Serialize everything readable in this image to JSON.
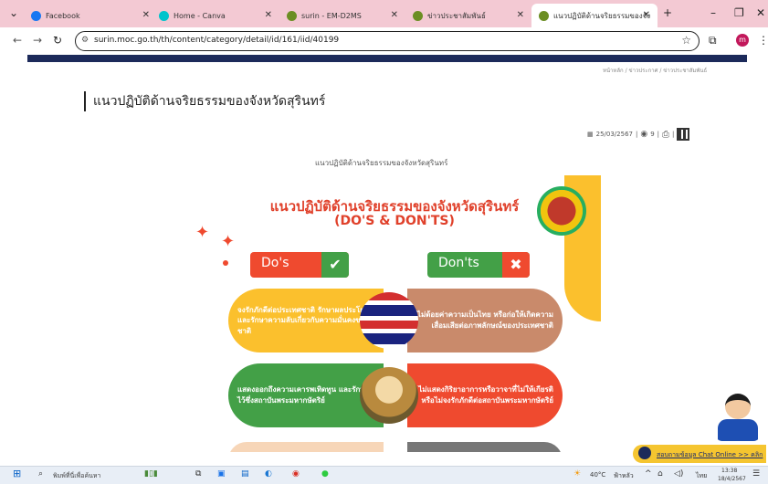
{
  "browser": {
    "tabs": [
      {
        "title": "Facebook",
        "color": "#1877f2",
        "active": false
      },
      {
        "title": "Home - Canva",
        "color": "#00c4cc",
        "active": false
      },
      {
        "title": "surin - EM-D2MS",
        "color": "#6b8e23",
        "active": false
      },
      {
        "title": "ข่าวประชาสัมพันธ์",
        "color": "#6b8e23",
        "active": false
      },
      {
        "title": "แนวปฏิบัติด้านจริยธรรมของจังหวัดสุ",
        "color": "#6b8e23",
        "active": true
      }
    ],
    "new_tab": "+",
    "url": "surin.moc.go.th/th/content/category/detail/id/161/iid/40199",
    "profile_initial": "m"
  },
  "page": {
    "breadcrumb": "หน้าหลัก / ข่าวประกาศ / ข่าวประชาสัมพันธ์",
    "title": "แนวปฏิบัติด้านจริยธรรมของจังหวัดสุรินทร์",
    "date": "25/03/2567",
    "views": "9",
    "caption": "แนวปฏิบัติด้านจริยธรรมของจังหวัดสุรินทร์"
  },
  "poster": {
    "title": "แนวปฏิบัติด้านจริยธรรมของจังหวัดสุรินทร์",
    "subtitle": "(DO'S & DON'TS)",
    "dos_label": "Do's",
    "donts_label": "Don'ts",
    "dos": [
      "จงรักภักดีต่อประเทศชาติ รักษาผลประโยชน์ และรักษาความลับเกี่ยวกับความมั่นคงของชาติ",
      "แสดงออกถึงความเคารพเทิดทูน และรักษาไว้ซึ่งสถาบันพระมหากษัตริย์"
    ],
    "donts": [
      "ไม่ด้อยค่าความเป็นไทย หรือก่อให้เกิดความเสื่อมเสียต่อภาพลักษณ์ของประเทศชาติ",
      "ไม่แสดงกิริยาอาการหรือวาจาที่ไม่ให้เกียรติหรือไม่จงรักภักดีต่อสถาบันพระมหากษัตริย์"
    ],
    "colors": {
      "red": "#ef4a2f",
      "green": "#43a047",
      "yellow": "#fbc02d",
      "brown": "#c98a6b"
    }
  },
  "chat": {
    "label": "สอบถามข้อมูล Chat Online >> คลิก"
  },
  "taskbar": {
    "search_placeholder": "พิมพ์ที่นี่เพื่อค้นหา",
    "temperature": "40°C",
    "weather": "ฟ้าหลัว",
    "language": "ไทย",
    "time": "13:38",
    "date": "18/4/2567"
  }
}
